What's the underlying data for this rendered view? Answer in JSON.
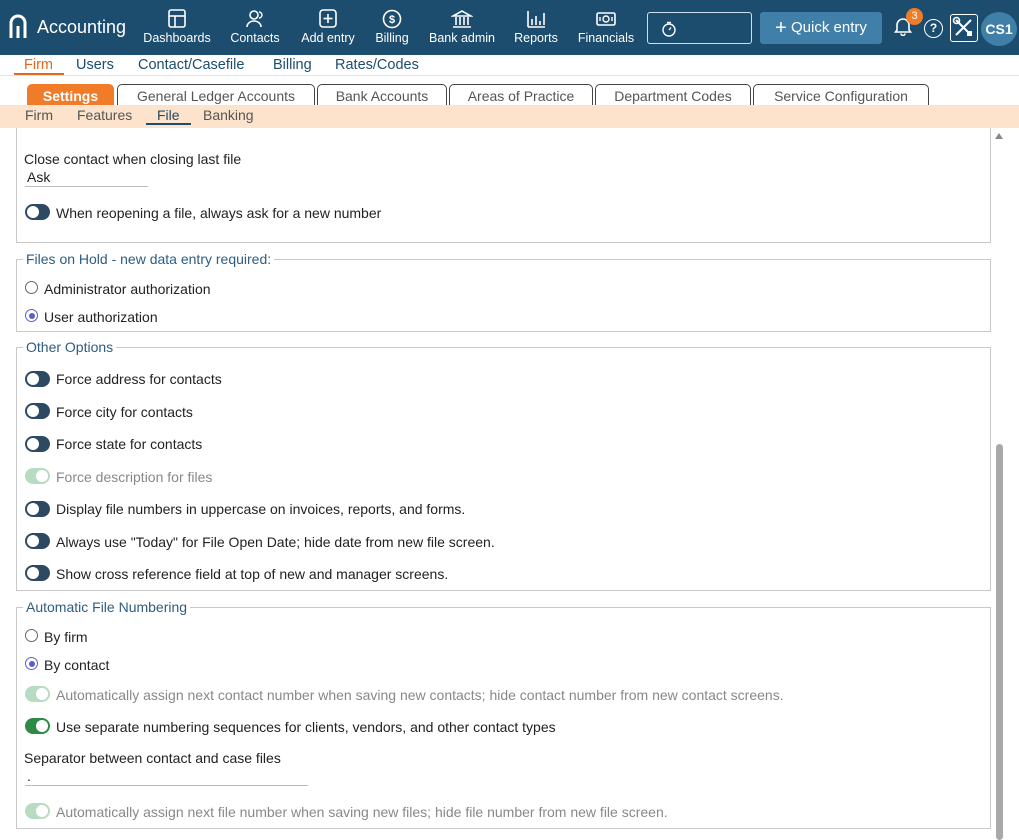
{
  "app": {
    "name": "Accounting"
  },
  "nav": [
    {
      "label": "Dashboards",
      "icon": "dashboard-icon"
    },
    {
      "label": "Contacts",
      "icon": "contacts-icon"
    },
    {
      "label": "Add entry",
      "icon": "add-entry-icon"
    },
    {
      "label": "Billing",
      "icon": "billing-icon"
    },
    {
      "label": "Bank admin",
      "icon": "bank-icon"
    },
    {
      "label": "Reports",
      "icon": "reports-icon"
    },
    {
      "label": "Financials",
      "icon": "financials-icon"
    }
  ],
  "header": {
    "quick_entry": "Quick entry",
    "notifications": "3",
    "avatar": "CS1"
  },
  "menu": [
    "Firm",
    "Users",
    "Contact/Casefile",
    "Billing",
    "Rates/Codes"
  ],
  "tabs": [
    "Settings",
    "General Ledger Accounts",
    "Bank Accounts",
    "Areas of Practice",
    "Department Codes",
    "Service Configuration"
  ],
  "subtabs": [
    "Firm",
    "Features",
    "File",
    "Banking"
  ],
  "close_contact": {
    "label": "Close contact when closing last file",
    "value": "Ask"
  },
  "reopen_toggle": "When reopening a file, always ask for a new number",
  "files_on_hold": {
    "title": "Files on Hold - new data entry required:",
    "options": [
      "Administrator authorization",
      "User authorization"
    ],
    "selected": "User authorization"
  },
  "other_options": {
    "title": "Other Options",
    "items": [
      "Force address for contacts",
      "Force city for contacts",
      "Force state for contacts",
      "Force description for files",
      "Display file numbers in uppercase on invoices, reports, and forms.",
      "Always use \"Today\" for File Open Date; hide date from new file screen.",
      "Show cross reference field at top of new and manager screens."
    ]
  },
  "auto_numbering": {
    "title": "Automatic File Numbering",
    "options": [
      "By firm",
      "By contact"
    ],
    "selected": "By contact",
    "assign_contact": "Automatically assign next contact number when saving new contacts; hide contact number from new contact screens.",
    "separate_sequences": "Use separate numbering sequences for clients, vendors, and other contact types",
    "separator_label": "Separator between contact and case files",
    "separator_value": ".",
    "assign_file": "Automatically assign next file number when saving new files; hide file number from new file screen."
  }
}
